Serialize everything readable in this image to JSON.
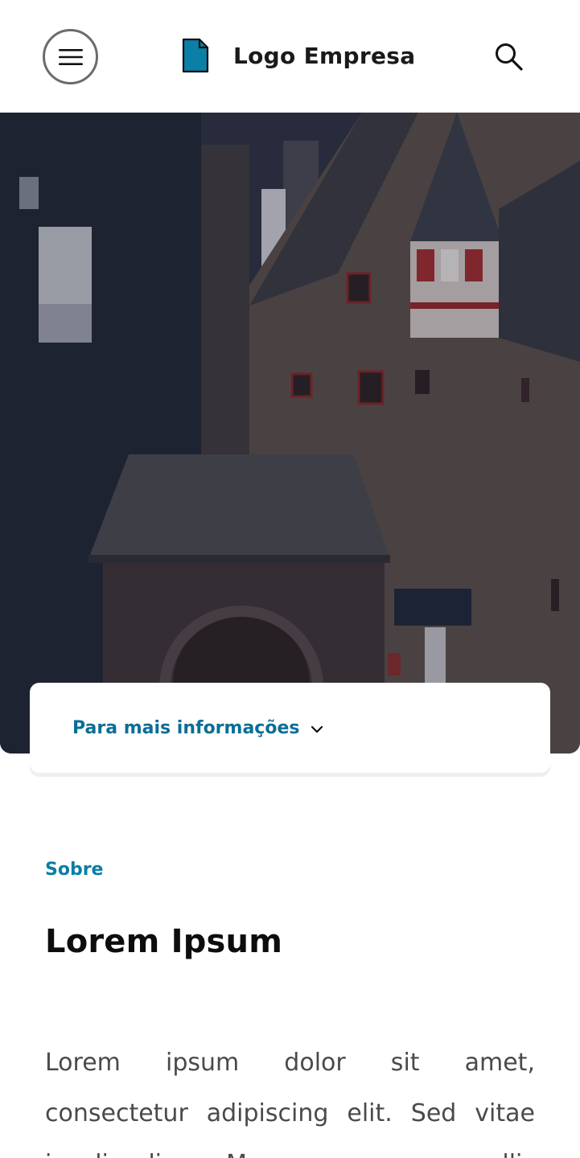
{
  "header": {
    "menu_icon": "hamburger-menu-icon",
    "logo_icon": "document-icon",
    "logo_text": "Logo Empresa",
    "search_icon": "search-icon"
  },
  "hero": {
    "image": "castle-photo-with-dark-overlay"
  },
  "info_card": {
    "label": "Para mais informações",
    "chevron_icon": "chevron-down-icon"
  },
  "about": {
    "kicker": "Sobre",
    "title": "Lorem Ipsum",
    "body": "Lorem ipsum dolor sit amet, consectetur adipiscing elit. Sed vitae iaculis diam. Maecenas non convallis"
  },
  "colors": {
    "accent": "#0a7ea4",
    "link": "#0a6e97",
    "logo_fill": "#0b7fa6",
    "hero_overlay": "#1c2233"
  }
}
